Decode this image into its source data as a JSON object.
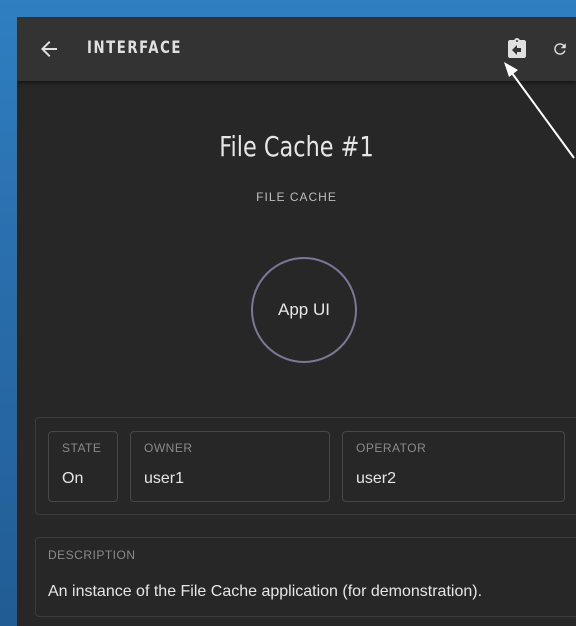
{
  "header": {
    "title": "INTERFACE",
    "back_icon": "arrow-left-icon",
    "actions": [
      {
        "icon": "open-interface-icon"
      },
      {
        "icon": "refresh-icon"
      }
    ]
  },
  "instance": {
    "title": "File Cache #1",
    "type": "FILE CACHE",
    "ui_button_label": "App UI"
  },
  "fields": {
    "state": {
      "label": "STATE",
      "value": "On"
    },
    "owner": {
      "label": "OWNER",
      "value": "user1"
    },
    "operator": {
      "label": "OPERATOR",
      "value": "user2"
    }
  },
  "description": {
    "label": "DESCRIPTION",
    "text": "An instance of the File Cache application (for demonstration)."
  },
  "colors": {
    "desktop": "#2a6fae",
    "surface": "#272727",
    "topbar": "#333333",
    "circle_border": "#7a7897",
    "text_primary": "#e6e6e6",
    "text_muted": "#8a8a8a"
  }
}
